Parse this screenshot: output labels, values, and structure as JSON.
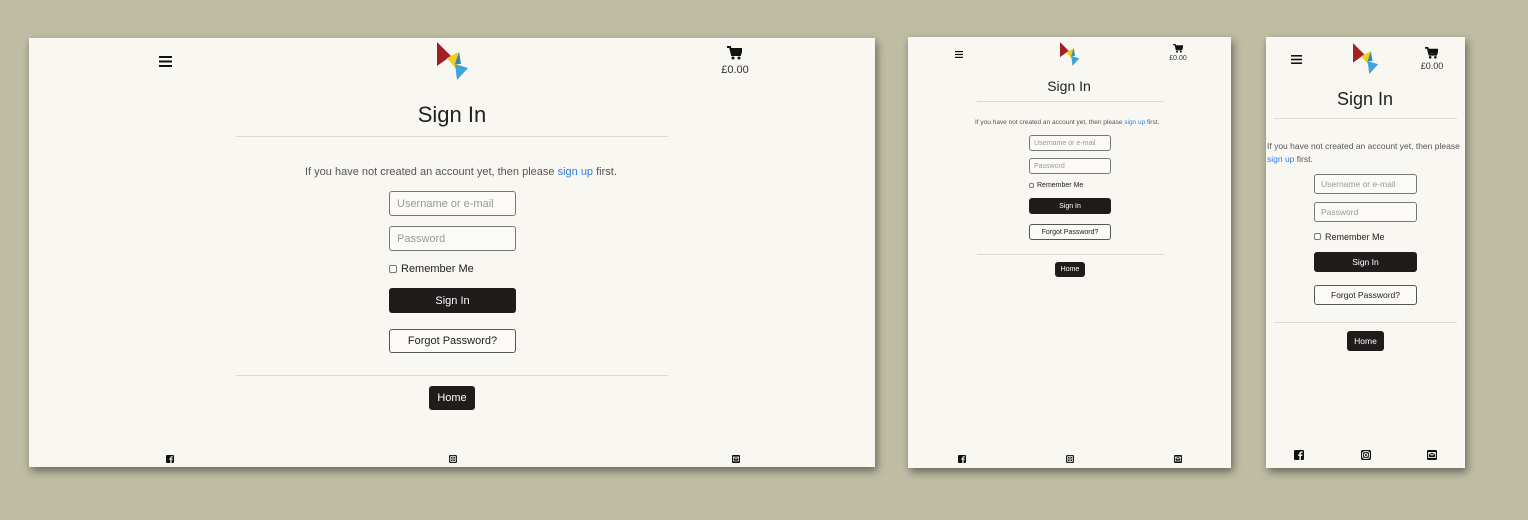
{
  "header": {
    "cart_total": "£0.00",
    "menu_icon": "hamburger-menu-icon",
    "cart_icon": "shopping-cart-icon",
    "logo_icon": "origami-bird-logo"
  },
  "signin": {
    "title": "Sign In",
    "intro_before": "If you have not created an account yet, then please",
    "signup_link": "sign up",
    "intro_after": "first.",
    "username_placeholder": "Username or e-mail",
    "password_placeholder": "Password",
    "remember_label": "Remember Me",
    "submit_label": "Sign In",
    "forgot_label": "Forgot Password?",
    "home_label": "Home"
  },
  "footer": {
    "icons": [
      "facebook-icon",
      "instagram-icon",
      "email-icon"
    ]
  },
  "colors": {
    "background": "#bebca3",
    "page": "#f9f7f1",
    "dark_button": "#1f1c1b",
    "link": "#2a7ee0",
    "logo_red": "#a31f24",
    "logo_yellow": "#f1cd1c",
    "logo_blue": "#3fa3dc"
  }
}
